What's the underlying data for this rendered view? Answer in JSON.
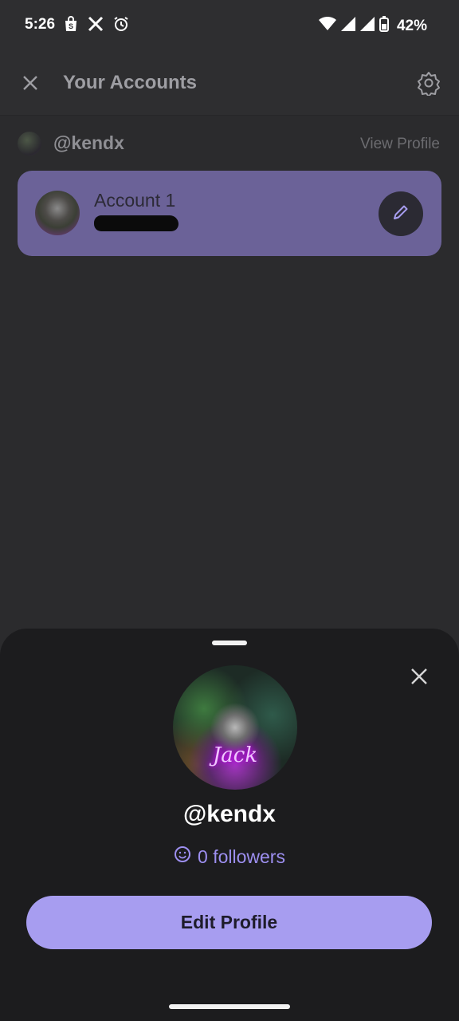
{
  "status_bar": {
    "time": "5:26",
    "battery": "42%",
    "icons": [
      "shopping-bag-icon",
      "x-logo-icon",
      "alarm-icon",
      "wifi-icon",
      "signal-icon",
      "signal-icon",
      "battery-icon"
    ]
  },
  "app_bar": {
    "title": "Your Accounts",
    "close_icon": "close-icon",
    "settings_icon": "gear-icon"
  },
  "account_header": {
    "username": "@kendx",
    "link": "View Profile"
  },
  "account_card": {
    "name": "Account 1",
    "edit_icon": "pencil-icon",
    "background": "#6b6298"
  },
  "sheet": {
    "username": "@kendx",
    "avatar_text": "Jack",
    "followers": "0 followers",
    "button": "Edit Profile",
    "accent": "#a79df0"
  }
}
